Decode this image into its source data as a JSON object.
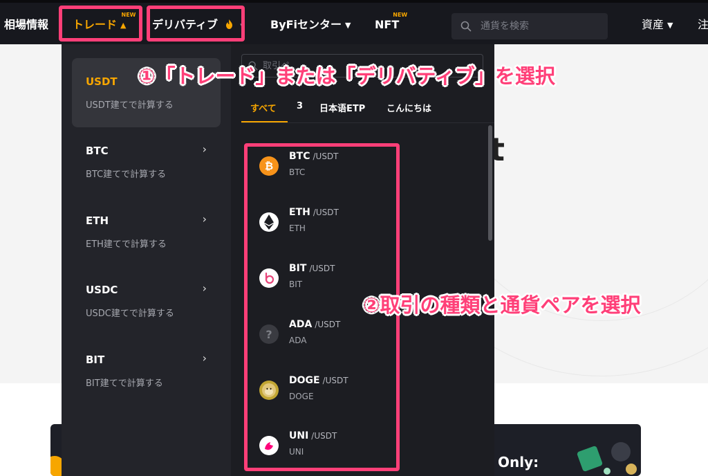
{
  "nav": {
    "items": [
      {
        "label": "相場情報"
      },
      {
        "label": "トレード",
        "badge": "NEW"
      },
      {
        "label": "デリバティブ"
      },
      {
        "label": "ByFiセンター"
      },
      {
        "label": "NFT",
        "badge": "NEW"
      }
    ],
    "search_placeholder": "通貨を検索",
    "assets_label": "資産",
    "orders_label": "注"
  },
  "dropdown": {
    "categories": [
      {
        "title": "USDT",
        "subtitle": "USDT建てで計算する"
      },
      {
        "title": "BTC",
        "subtitle": "BTC建てで計算する"
      },
      {
        "title": "ETH",
        "subtitle": "ETH建てで計算する"
      },
      {
        "title": "USDC",
        "subtitle": "USDC建てで計算する"
      },
      {
        "title": "BIT",
        "subtitle": "BIT建てで計算する"
      }
    ],
    "search_placeholder": "取引ペ",
    "tabs": [
      {
        "label": "すべて"
      },
      {
        "label": "3"
      },
      {
        "label": "日本语ETP"
      },
      {
        "label": "こんにちは"
      }
    ],
    "pairs": [
      {
        "symbol": "BTC",
        "quote": "/USDT",
        "name": "BTC",
        "icon": "bitcoin-icon"
      },
      {
        "symbol": "ETH",
        "quote": "/USDT",
        "name": "ETH",
        "icon": "ethereum-icon"
      },
      {
        "symbol": "BIT",
        "quote": "/USDT",
        "name": "BIT",
        "icon": "bitdao-icon"
      },
      {
        "symbol": "ADA",
        "quote": "/USDT",
        "name": "ADA",
        "icon": "question-mark-icon"
      },
      {
        "symbol": "DOGE",
        "quote": "/USDT",
        "name": "DOGE",
        "icon": "dogecoin-icon"
      },
      {
        "symbol": "UNI",
        "quote": "/USDT",
        "name": "UNI",
        "icon": "uniswap-icon"
      }
    ]
  },
  "background": {
    "hero_text": "t",
    "promo_text": "Only:"
  },
  "annotations": {
    "step1": "①「トレード」または「デリバティブ」を選択",
    "step2": "②取引の種類と通貨ペアを選択"
  },
  "colors": {
    "accent": "#f7a600",
    "annotation": "#ff3f78",
    "nav_bg": "#17181e",
    "dropdown_bg": "#1c1d22"
  }
}
